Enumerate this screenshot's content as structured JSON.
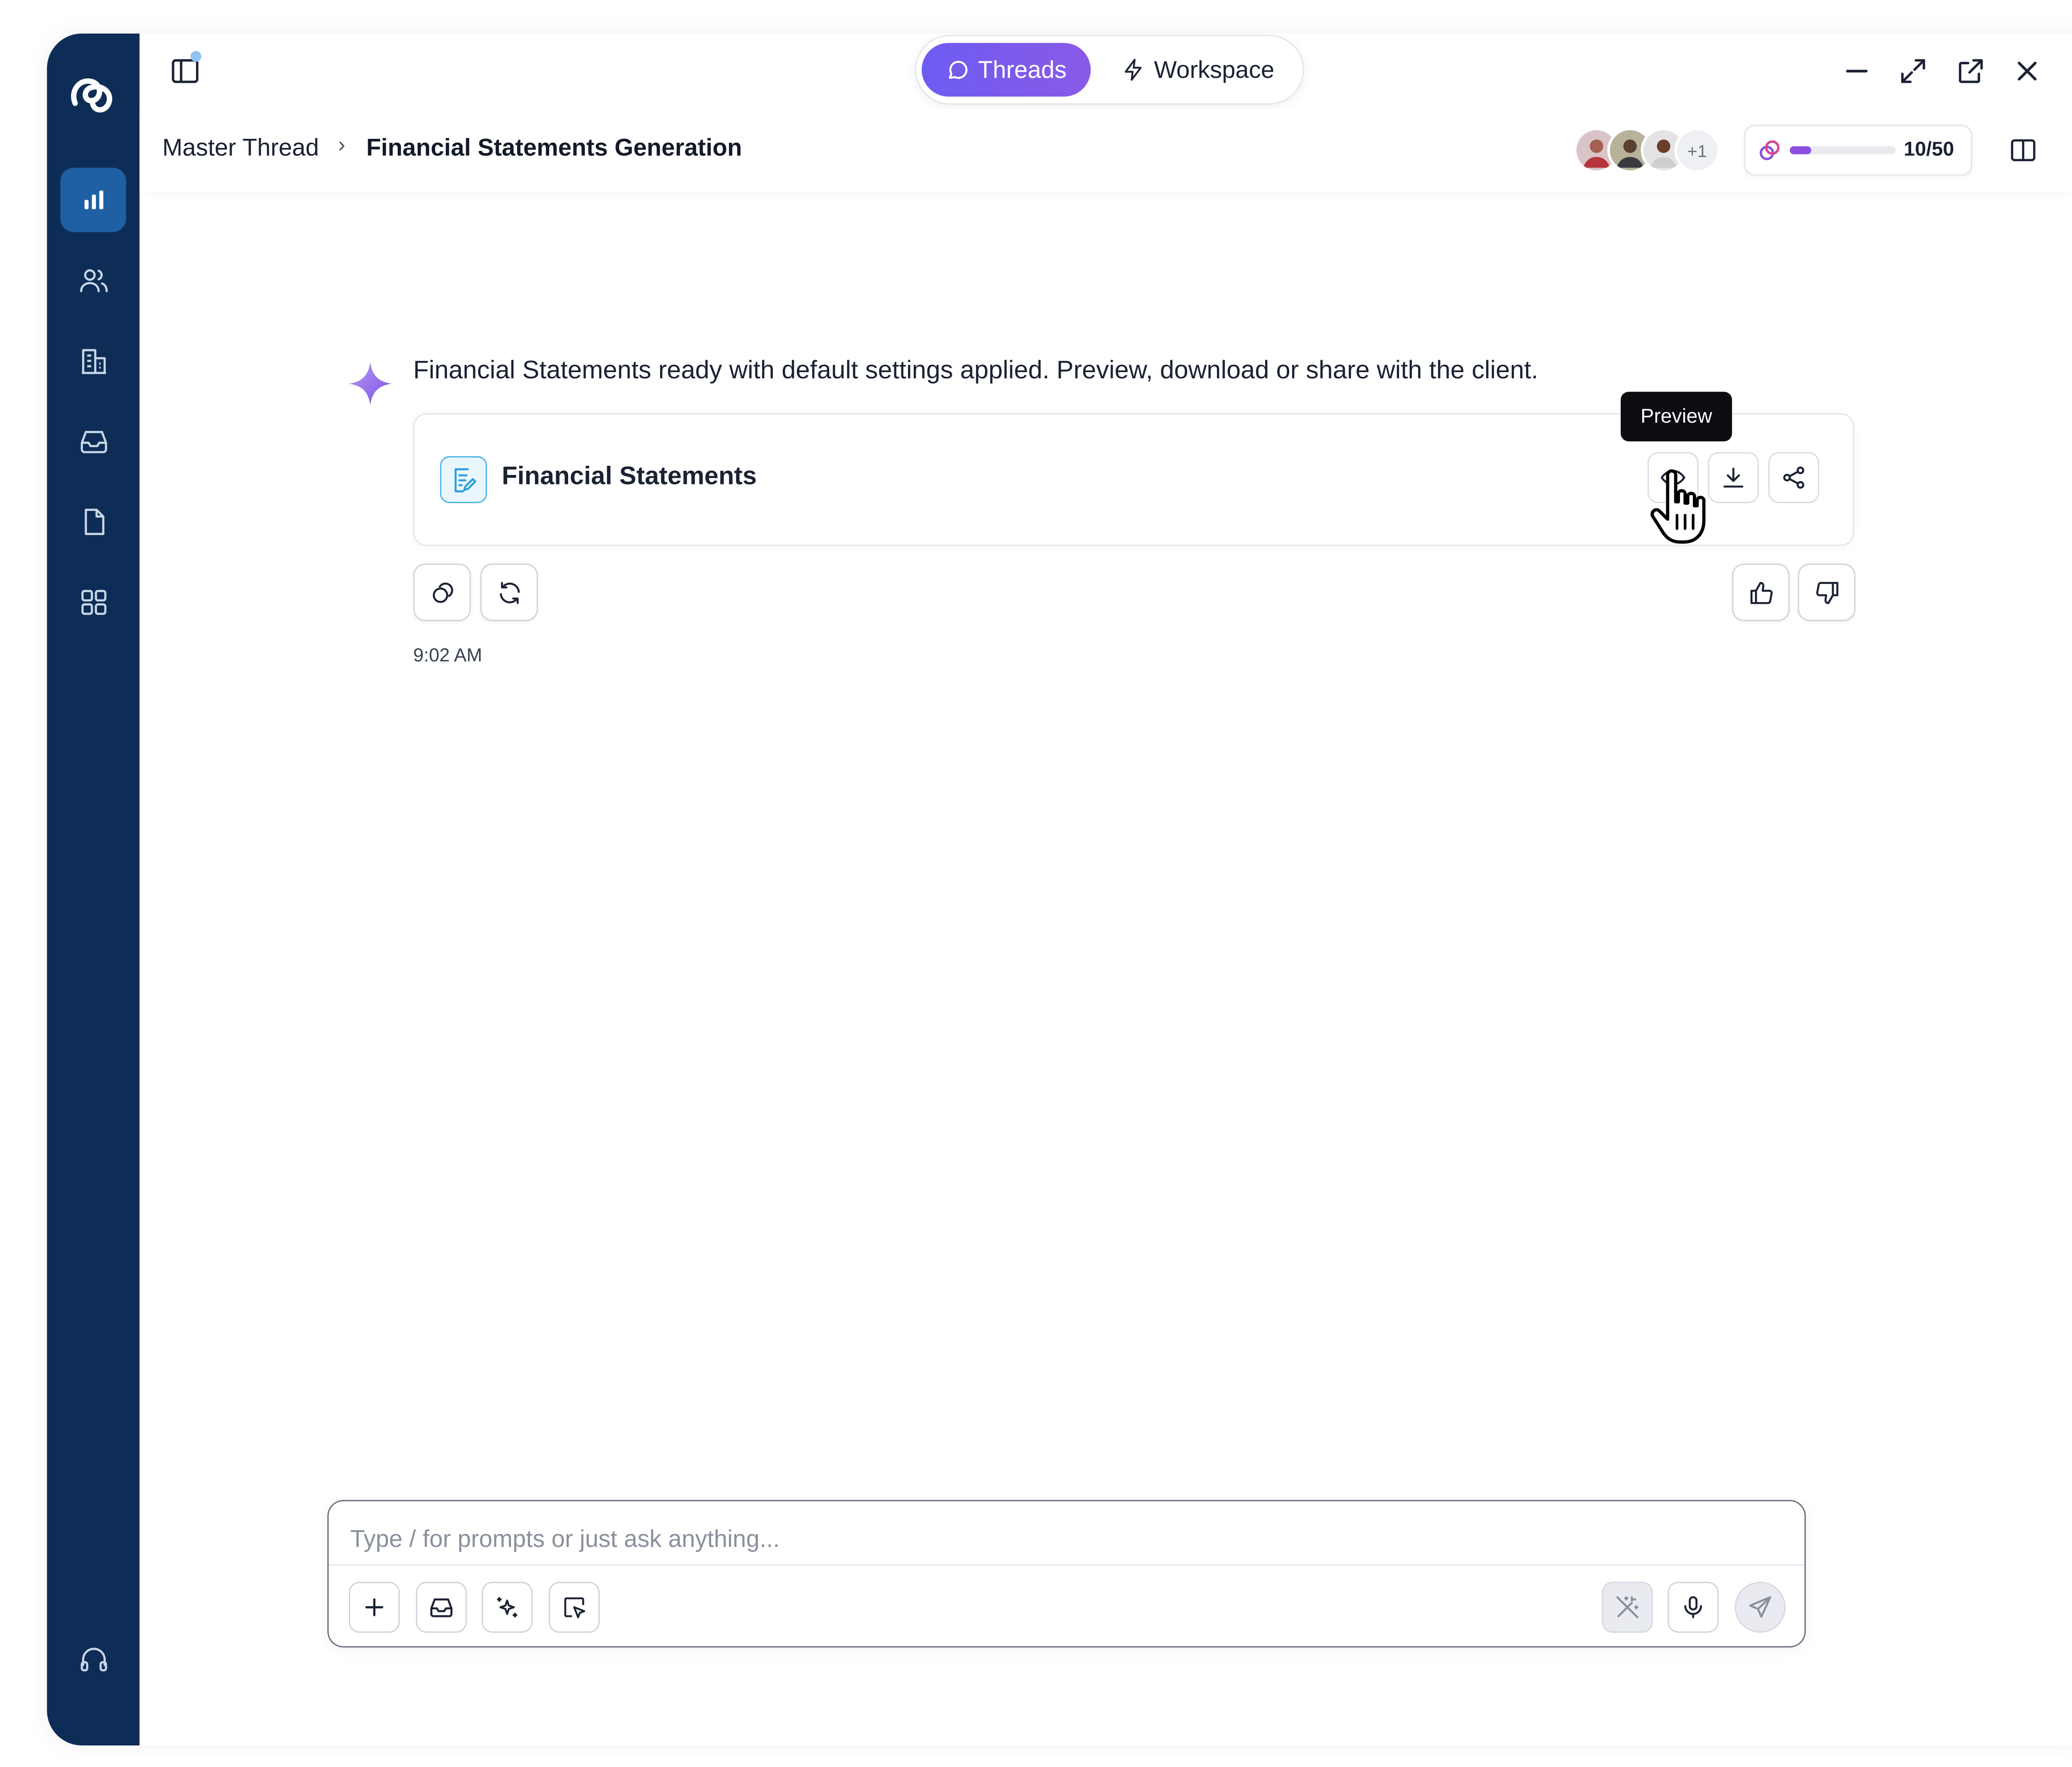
{
  "topbar": {
    "tabs": [
      {
        "label": "Threads",
        "active": true
      },
      {
        "label": "Workspace",
        "active": false
      }
    ]
  },
  "breadcrumb": {
    "parent": "Master Thread",
    "separator": "›",
    "current": "Financial Statements Generation"
  },
  "collaborators": {
    "extra_count": "+1"
  },
  "credits": {
    "used": 10,
    "total": 50,
    "label": "10/50",
    "fraction": 0.2
  },
  "message": {
    "text": "Financial Statements ready with default settings applied. Preview, download or share with the client.",
    "timestamp": "9:02 AM",
    "card": {
      "title": "Financial Statements",
      "tooltip": "Preview"
    }
  },
  "composer": {
    "placeholder": "Type / for prompts or just ask anything..."
  },
  "colors": {
    "sidebar_bg": "#0e2d56",
    "sidebar_active": "#1f5fa3",
    "accent_purple": "#6d5cf2",
    "credits_fill": "#8a4fe0",
    "doc_icon_blue": "#4fb6e8"
  },
  "icons": {
    "sidebar": [
      "dashboard-chart-icon",
      "users-icon",
      "building-icon",
      "inbox-icon",
      "document-icon",
      "apps-grid-icon",
      "headset-icon"
    ],
    "window": [
      "minimize-icon",
      "expand-icon",
      "external-link-icon",
      "close-icon"
    ]
  }
}
